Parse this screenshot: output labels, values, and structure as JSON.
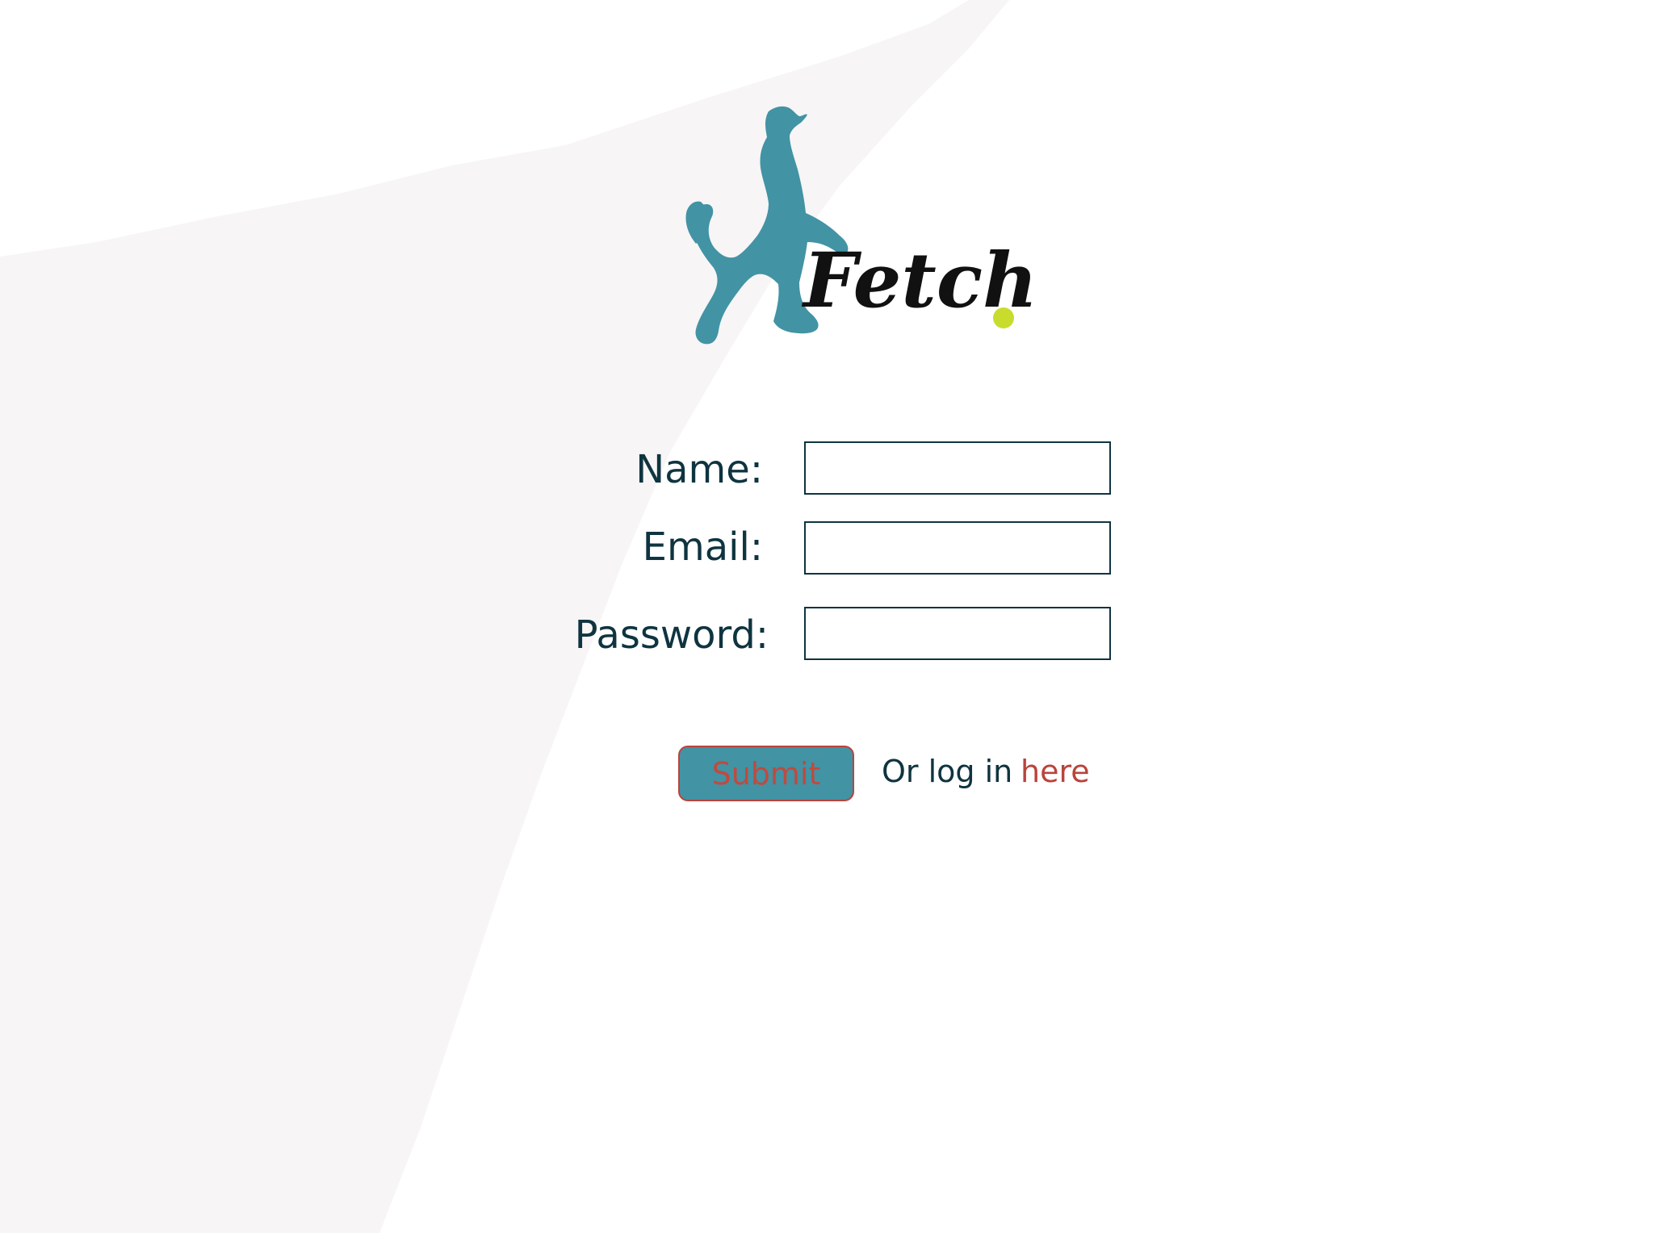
{
  "brand": {
    "name": "Fetch",
    "logo_color": "#4293a4",
    "ball_color": "#c8dc2e",
    "text_color": "#111111"
  },
  "form": {
    "name_label": "Name:",
    "name_value": "",
    "email_label": "Email:",
    "email_value": "",
    "password_label": "Password:",
    "password_value": "",
    "submit_label": "Submit",
    "login_prompt": "Or log in",
    "login_link": "here"
  },
  "colors": {
    "primary": "#4293a4",
    "accent": "#b9443c",
    "text": "#0f3440",
    "background_shape": "#f7f5f6"
  }
}
